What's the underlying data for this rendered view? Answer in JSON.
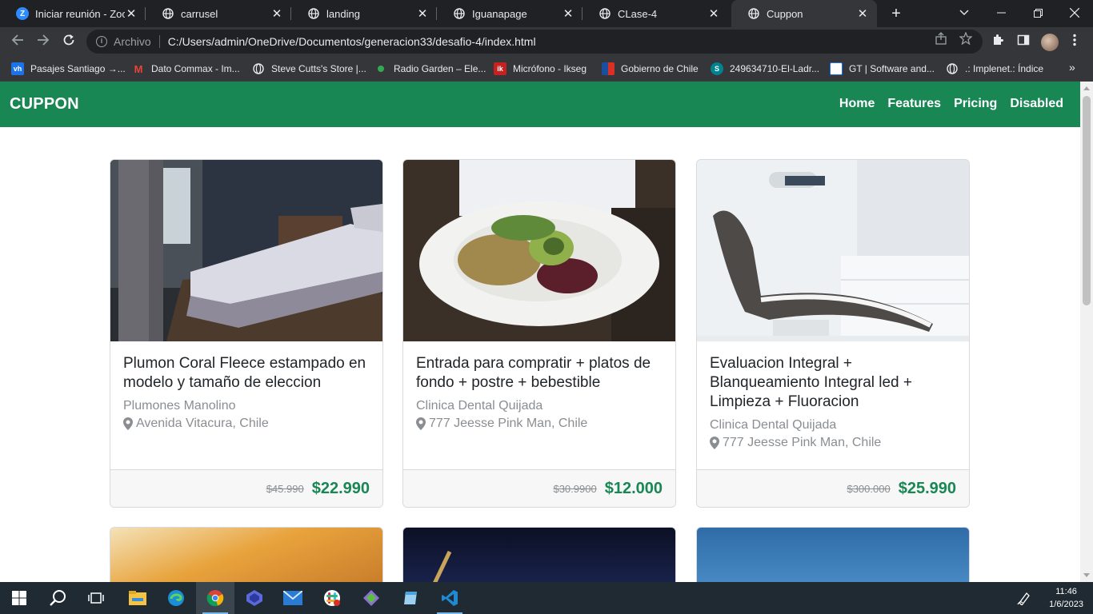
{
  "browser": {
    "tabs": [
      {
        "title": "Iniciar reunión - Zoom",
        "icon": "zoom-icon",
        "active": false
      },
      {
        "title": "carrusel",
        "icon": "globe-icon",
        "active": false
      },
      {
        "title": "landing",
        "icon": "globe-icon",
        "active": false
      },
      {
        "title": "Iguanapage",
        "icon": "globe-icon",
        "active": false
      },
      {
        "title": "CLase-4",
        "icon": "globe-icon",
        "active": false
      },
      {
        "title": "Cuppon",
        "icon": "globe-icon",
        "active": true
      }
    ],
    "close_glyph": "✕",
    "new_tab_glyph": "+",
    "address": {
      "scheme_label": "Archivo",
      "url": "C:/Users/admin/OneDrive/Documentos/generacion33/desafio-4/index.html"
    },
    "bookmarks": [
      {
        "label": "Pasajes Santiago →...",
        "icon_text": "vh",
        "color": "#1a73e8"
      },
      {
        "label": "Dato Commax - Im...",
        "icon_text": "M",
        "color": "#ea4335"
      },
      {
        "label": "Steve Cutts's Store |...",
        "icon_text": "",
        "color": "#9aa0a6"
      },
      {
        "label": "Radio Garden – Ele...",
        "icon_text": "",
        "color": "#34a853"
      },
      {
        "label": "Micrófono - Ikseg",
        "icon_text": "ik",
        "color": "#c5221f"
      },
      {
        "label": "Gobierno de Chile",
        "icon_text": "",
        "color": "#1a4fa0"
      },
      {
        "label": "249634710-El-Ladr...",
        "icon_text": "S",
        "color": "#00838f"
      },
      {
        "label": "GT | Software and...",
        "icon_text": "",
        "color": "#ffffff"
      },
      {
        "label": ".: Implenet.: Índice",
        "icon_text": "",
        "color": "#9aa0a6"
      }
    ],
    "more_glyph": "»"
  },
  "site": {
    "brand": "CUPPON",
    "nav": [
      "Home",
      "Features",
      "Pricing",
      "Disabled"
    ],
    "accent": "#198754",
    "cards": [
      {
        "title": "Plumon Coral Fleece estampado en modelo y tamaño de eleccion",
        "store": "Plumones Manolino",
        "location": "Avenida Vitacura, Chile",
        "old_price": "$45.990",
        "new_price": "$22.990",
        "image": "bedroom-photo"
      },
      {
        "title": "Entrada para compratir + platos de fondo + postre + bebestible",
        "store": "Clinica Dental Quijada",
        "location": "777 Jeesse Pink Man, Chile",
        "old_price": "$30.9900",
        "new_price": "$12.000",
        "image": "salad-photo"
      },
      {
        "title": "Evaluacion Integral + Blanqueamiento Integral led + Limpieza + Fluoracion",
        "store": "Clinica Dental Quijada",
        "location": "777 Jeesse Pink Man, Chile",
        "old_price": "$300.000",
        "new_price": "$25.990",
        "image": "dental-chair-photo"
      }
    ]
  },
  "taskbar": {
    "time": "11:46",
    "date": "1/6/2023"
  }
}
